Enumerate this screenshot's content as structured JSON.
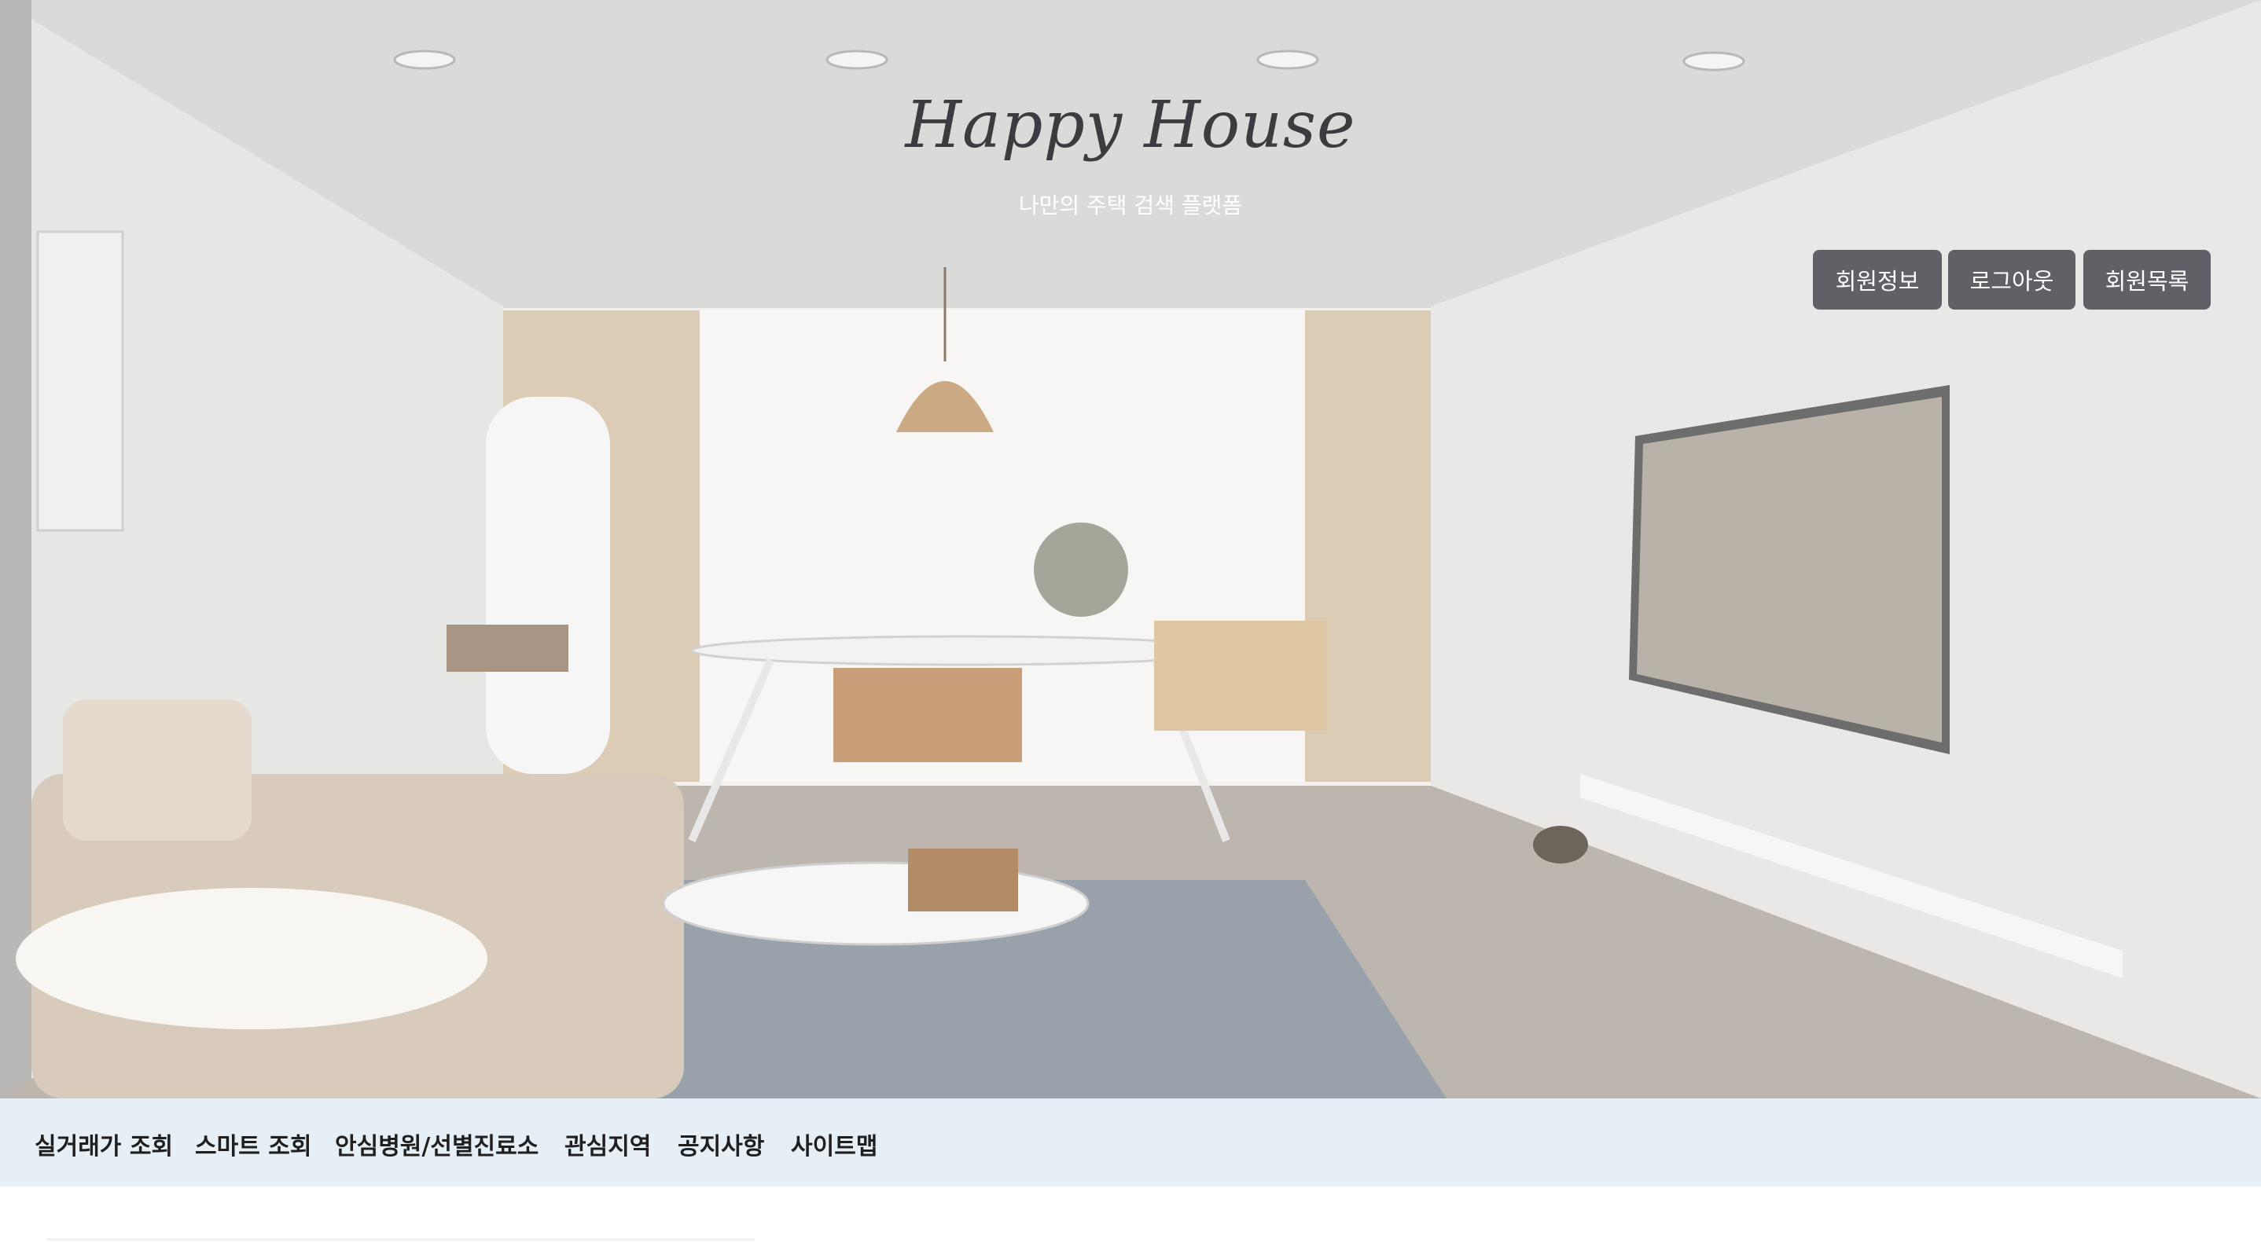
{
  "header": {
    "title": "Happy House",
    "subtitle": "나만의 주택 검색 플랫폼",
    "buttons": [
      {
        "label": "회원정보"
      },
      {
        "label": "로그아웃"
      },
      {
        "label": "회원목록"
      }
    ]
  },
  "nav": {
    "items": [
      {
        "label": "실거래가 조회"
      },
      {
        "label": "스마트 조회"
      },
      {
        "label": "안심병원/선별진료소"
      },
      {
        "label": "관심지역"
      },
      {
        "label": "공지사항"
      },
      {
        "label": "사이트맵"
      }
    ]
  },
  "colors": {
    "button_bg": "#5f6166",
    "nav_bg": "#e6eff6",
    "title": "#3c3c40"
  }
}
